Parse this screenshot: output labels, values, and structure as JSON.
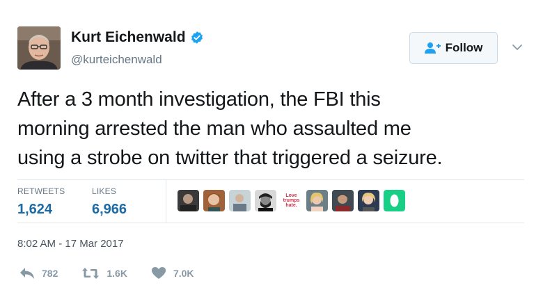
{
  "user": {
    "display_name": "Kurt Eichenwald",
    "handle": "@kurteichenwald",
    "verified": true
  },
  "follow_button": {
    "label": "Follow",
    "icon": "follow-person-plus-icon"
  },
  "tweet": {
    "lines": [
      "After a 3 month investigation, the FBI this",
      "morning arrested the man who assaulted me",
      "using a strobe on twitter that triggered a seizure."
    ]
  },
  "stats": {
    "retweets_label": "RETWEETS",
    "retweets_value": "1,624",
    "likes_label": "LIKES",
    "likes_value": "6,966"
  },
  "likers": {
    "text_avatar_label": "Love trumps hate.",
    "count": 9
  },
  "timestamp": "8:02 AM - 17 Mar 2017",
  "actions": {
    "reply_count": "782",
    "retweet_count": "1.6K",
    "like_count": "7.0K"
  },
  "colors": {
    "verified": "#1da1f2",
    "stat_value": "#1b6aa5",
    "muted": "#657786",
    "divider": "#e1e8ed"
  }
}
